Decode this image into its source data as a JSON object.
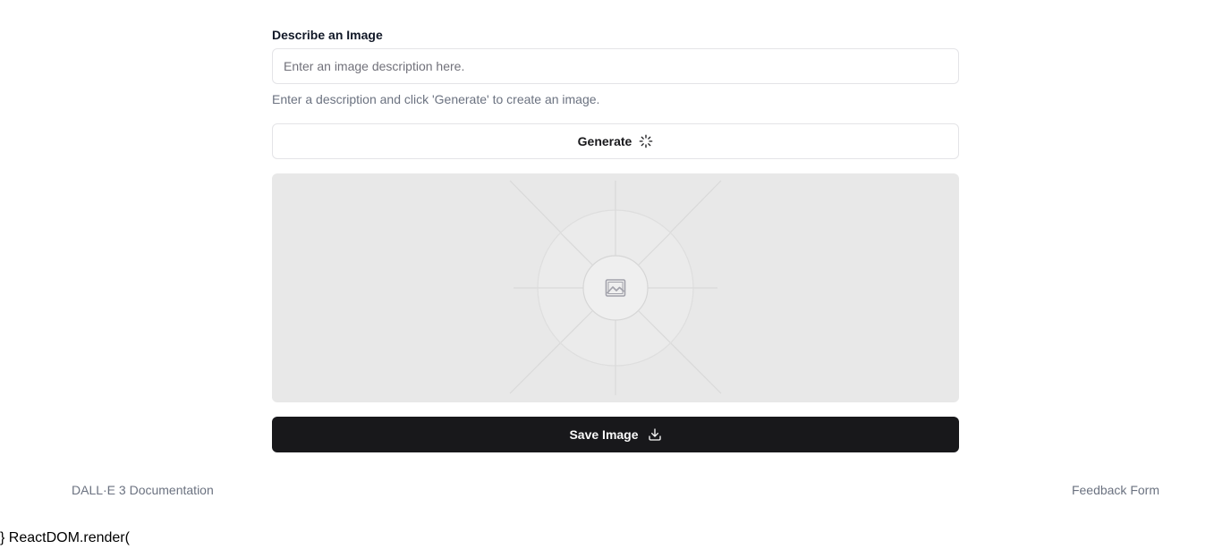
{
  "form": {
    "label": "Describe an Image",
    "input_placeholder": "Enter an image description here.",
    "input_value": "",
    "helper_text": "Enter a description and click 'Generate' to create an image."
  },
  "generate_button": {
    "label": "Generate",
    "icon": "loader-icon"
  },
  "image_placeholder": {
    "icon": "image-icon"
  },
  "save_button": {
    "label": "Save Image",
    "icon": "download-icon"
  },
  "footer": {
    "left_link": "DALL·E 3 Documentation",
    "right_link": "Feedback Form"
  },
  "stray_text": "} ReactDOM.render(",
  "colors": {
    "primary": "#18181b",
    "border": "#e4e4e7",
    "muted_text": "#6b7280",
    "placeholder_bg": "#e8e8e8"
  }
}
